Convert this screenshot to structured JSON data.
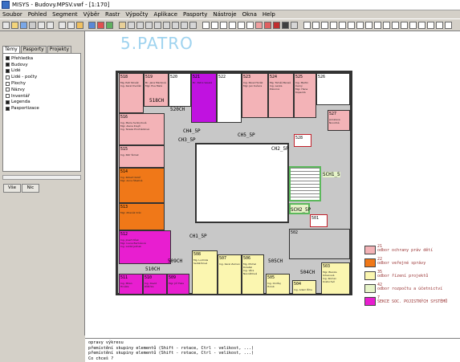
{
  "window": {
    "title": "MISYS - Budovy.MPSV.vwf - [1:170]"
  },
  "menu": [
    "Soubor",
    "Pohled",
    "Segment",
    "Výběr",
    "Rastr",
    "Výpočty",
    "Aplikace",
    "Pasporty",
    "Nástroje",
    "Okna",
    "Help"
  ],
  "sidebar": {
    "tabs": [
      "Témy",
      "Pasporty",
      "Projekty"
    ],
    "layers": [
      {
        "label": "Přehledka",
        "checked": true
      },
      {
        "label": "Budovy",
        "checked": true
      },
      {
        "label": "Lidé",
        "checked": true
      },
      {
        "label": "Lidé - počty",
        "checked": false
      },
      {
        "label": "Plochy",
        "checked": false
      },
      {
        "label": "Názvy",
        "checked": false
      },
      {
        "label": "Inventář",
        "checked": false
      },
      {
        "label": "Legenda",
        "checked": true
      },
      {
        "label": "Pasportizace",
        "checked": true
      }
    ],
    "buttons": {
      "all": "Vše",
      "none": "Nic"
    }
  },
  "floorplan": {
    "title": "5.PATRO",
    "rooms": [
      {
        "id": "518",
        "text": "Mg. Petr Novák\nIng. Karel Dvořák"
      },
      {
        "id": "519",
        "text": "Bc. Jana Marková\nMgr. Eva Malá"
      },
      {
        "id": "520",
        "text": ""
      },
      {
        "id": "521",
        "text": "Bc. Petra Veselá"
      },
      {
        "id": "522",
        "text": ""
      },
      {
        "id": "523",
        "text": "Ing. Pavel Horák\nMgr. Jan Kučera"
      },
      {
        "id": "524",
        "text": "Mg. Tomáš Beneš\nIng. Lenka Pokorná"
      },
      {
        "id": "525",
        "text": "Ing. Martin Černý\nMgr. Hana Kopecká"
      },
      {
        "id": "526",
        "text": ""
      },
      {
        "id": "527",
        "text": "Jaroslava Novotná"
      },
      {
        "id": "528",
        "text": ""
      },
      {
        "id": "516",
        "text": "Ing. Marie Svobodová\nMgr. Alena Krejčí\nIng. Tereza Procházková"
      },
      {
        "id": "515",
        "text": "Ing. Petr Šimek"
      },
      {
        "id": "514",
        "text": "Ing. Robert Kolář\nMgr. Anna Šťastná"
      },
      {
        "id": "513",
        "text": "Mgr. Zdeněk Král"
      },
      {
        "id": "512",
        "text": "Ing. Josef Vlček\nMgr. Ivana Bartošová\nIng. Lukáš Jelínek"
      },
      {
        "id": "511",
        "text": "Ing. Milan Hruška"
      },
      {
        "id": "510",
        "text": "Ing. David Růžička"
      },
      {
        "id": "509",
        "text": "Mgr. Jiří Fiala"
      },
      {
        "id": "508",
        "text": "Mg. Ludmila Sedláčková"
      },
      {
        "id": "507",
        "text": "Ing. Karel Zeman"
      },
      {
        "id": "506",
        "text": "Mg. Michal Doležal\nIng. Věra Navrátilová"
      },
      {
        "id": "505",
        "text": "Ing. Ondřej Holub"
      },
      {
        "id": "504",
        "text": "Ing. Adam Říha"
      },
      {
        "id": "503",
        "text": "Mgr. Blanka Urbanová\nIng. Roman Kratochvíl"
      },
      {
        "id": "502",
        "text": ""
      },
      {
        "id": "501",
        "text": ""
      }
    ],
    "labels": [
      "518CH",
      "520CH",
      "CH4_5P",
      "CH3_5P",
      "CH5_5P",
      "CH2_5P",
      "SCH1_5",
      "SCH2_5P",
      "CH1_5P",
      "509CH",
      "510CH",
      "505CH",
      "504CH"
    ],
    "legend": [
      {
        "code": "21",
        "text": "odbor ochrany práv dětí",
        "color": "#f3b3b7"
      },
      {
        "code": "22",
        "text": "odbor veřejné správy",
        "color": "#f07818"
      },
      {
        "code": "35",
        "text": "odbor řízení projektů",
        "color": "#fbf6b0"
      },
      {
        "code": "42",
        "text": "odbor rozpočtu a účetnictví",
        "color": "#e6f4c8"
      },
      {
        "code": "7",
        "text": "SEKCE SOC. POJISTNÝCH SYSTÉMŮ",
        "color": "#e81ed0"
      }
    ]
  },
  "console": {
    "lines": [
      "opravy výkresu",
      "přemístění skupiny elementů (Shift - rotace, Ctrl - velikost, ...)",
      "přemístění skupiny elementů (Shift - rotace, Ctrl - velikost, ...)",
      "Co chceš ?"
    ]
  }
}
